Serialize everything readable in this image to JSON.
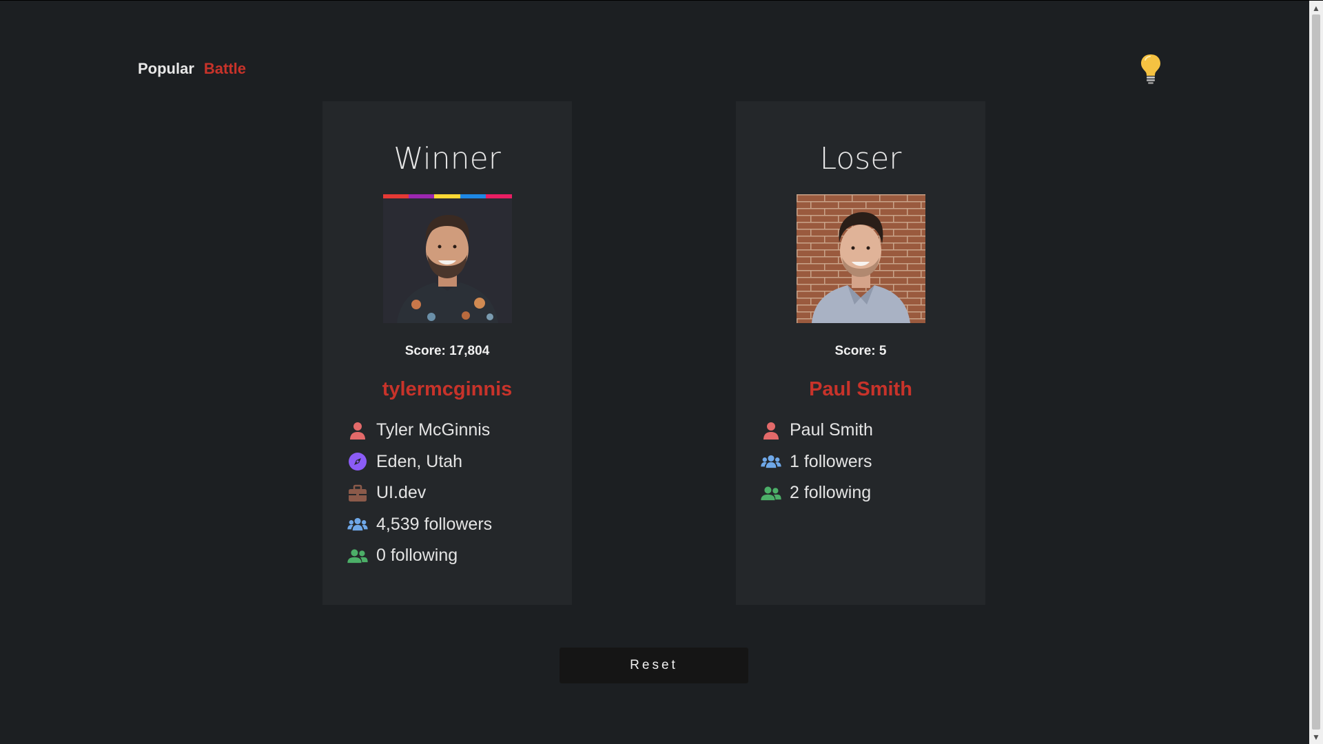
{
  "nav": {
    "popular_label": "Popular",
    "battle_label": "Battle"
  },
  "theme_toggle": {
    "icon": "lightbulb-icon",
    "color": "#f5c242"
  },
  "colors": {
    "background": "#1c1f22",
    "card": "#24272a",
    "accent_red": "#c8332a",
    "person_icon": "#e36a6a",
    "location_icon": "#8b5cf6",
    "company_icon": "#8b5a4a",
    "followers_icon": "#6fa8e8",
    "following_icon": "#4caf68"
  },
  "winner": {
    "header": "Winner",
    "score_text": "Score: 17,804",
    "username": "tylermcginnis",
    "info": [
      {
        "icon": "user-icon",
        "text": "Tyler McGinnis"
      },
      {
        "icon": "compass-icon",
        "text": "Eden, Utah"
      },
      {
        "icon": "briefcase-icon",
        "text": "UI.dev"
      },
      {
        "icon": "users-icon",
        "text": "4,539 followers"
      },
      {
        "icon": "user-friends-icon",
        "text": "0 following"
      }
    ],
    "avatar_stripe_colors": [
      "#e53935",
      "#9c27b0",
      "#fdd835",
      "#1e88e5",
      "#e91e63"
    ]
  },
  "loser": {
    "header": "Loser",
    "score_text": "Score: 5",
    "username": "Paul Smith",
    "info": [
      {
        "icon": "user-icon",
        "text": "Paul Smith"
      },
      {
        "icon": "users-icon",
        "text": "1 followers"
      },
      {
        "icon": "user-friends-icon",
        "text": "2 following"
      }
    ]
  },
  "reset_label": "Reset"
}
